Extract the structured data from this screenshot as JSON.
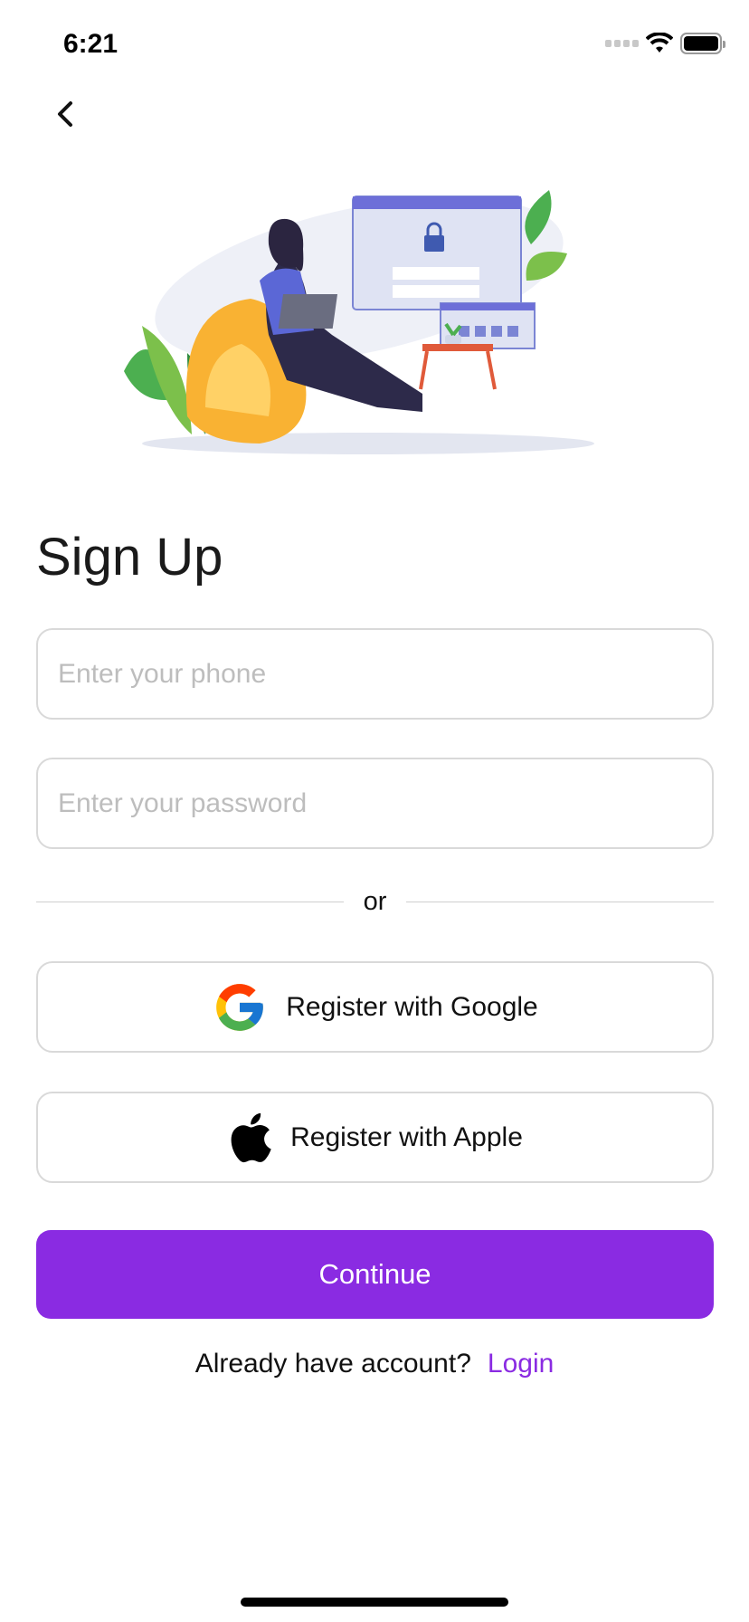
{
  "status_bar": {
    "time": "6:21",
    "icons": [
      "signal-icon",
      "wifi-icon",
      "battery-icon"
    ]
  },
  "nav": {
    "back_icon": "chevron-left-icon"
  },
  "page": {
    "title": "Sign Up"
  },
  "form": {
    "phone": {
      "placeholder": "Enter your phone",
      "value": ""
    },
    "password": {
      "placeholder": "Enter your password",
      "value": ""
    },
    "divider_text": "or",
    "google_label": "Register with Google",
    "apple_label": "Register with Apple",
    "continue_label": "Continue"
  },
  "footer": {
    "prompt": "Already have account?",
    "login_label": "Login"
  },
  "colors": {
    "accent": "#8a2be2",
    "border": "#d9d9d9",
    "placeholder": "#bdbdbd"
  }
}
